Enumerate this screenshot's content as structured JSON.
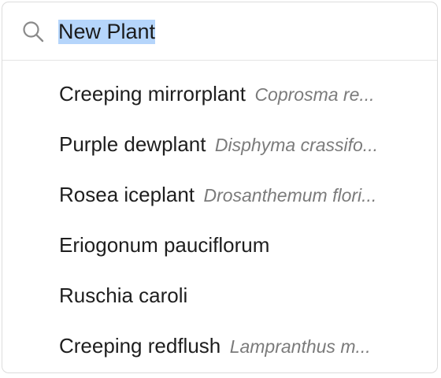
{
  "search": {
    "icon": "search-icon",
    "value": "New Plant",
    "selection_color": "#b5d5fb"
  },
  "results": [
    {
      "common": "Creeping mirrorplant",
      "scientific": "Coprosma re..."
    },
    {
      "common": "Purple dewplant",
      "scientific": "Disphyma crassifo..."
    },
    {
      "common": "Rosea iceplant",
      "scientific": "Drosanthemum flori..."
    },
    {
      "common": "Eriogonum pauciflorum",
      "scientific": ""
    },
    {
      "common": "Ruschia caroli",
      "scientific": ""
    },
    {
      "common": "Creeping redflush",
      "scientific": "Lampranthus m..."
    }
  ]
}
